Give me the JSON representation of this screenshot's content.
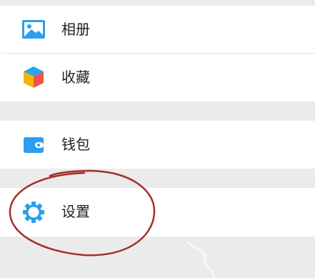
{
  "menu": {
    "items": [
      {
        "id": "album",
        "label": "相册",
        "icon": "album-icon"
      },
      {
        "id": "favorites",
        "label": "收藏",
        "icon": "cube-favorites-icon"
      },
      {
        "id": "wallet",
        "label": "钱包",
        "icon": "wallet-icon"
      },
      {
        "id": "settings",
        "label": "设置",
        "icon": "gear-icon"
      }
    ]
  },
  "annotation": {
    "shape": "hand-drawn-ellipse",
    "target": "settings",
    "color": "#a2302a"
  },
  "colors": {
    "icon_blue": "#2c9ef0",
    "row_background": "#ffffff",
    "section_gap": "#ebebeb",
    "text": "#222222"
  }
}
